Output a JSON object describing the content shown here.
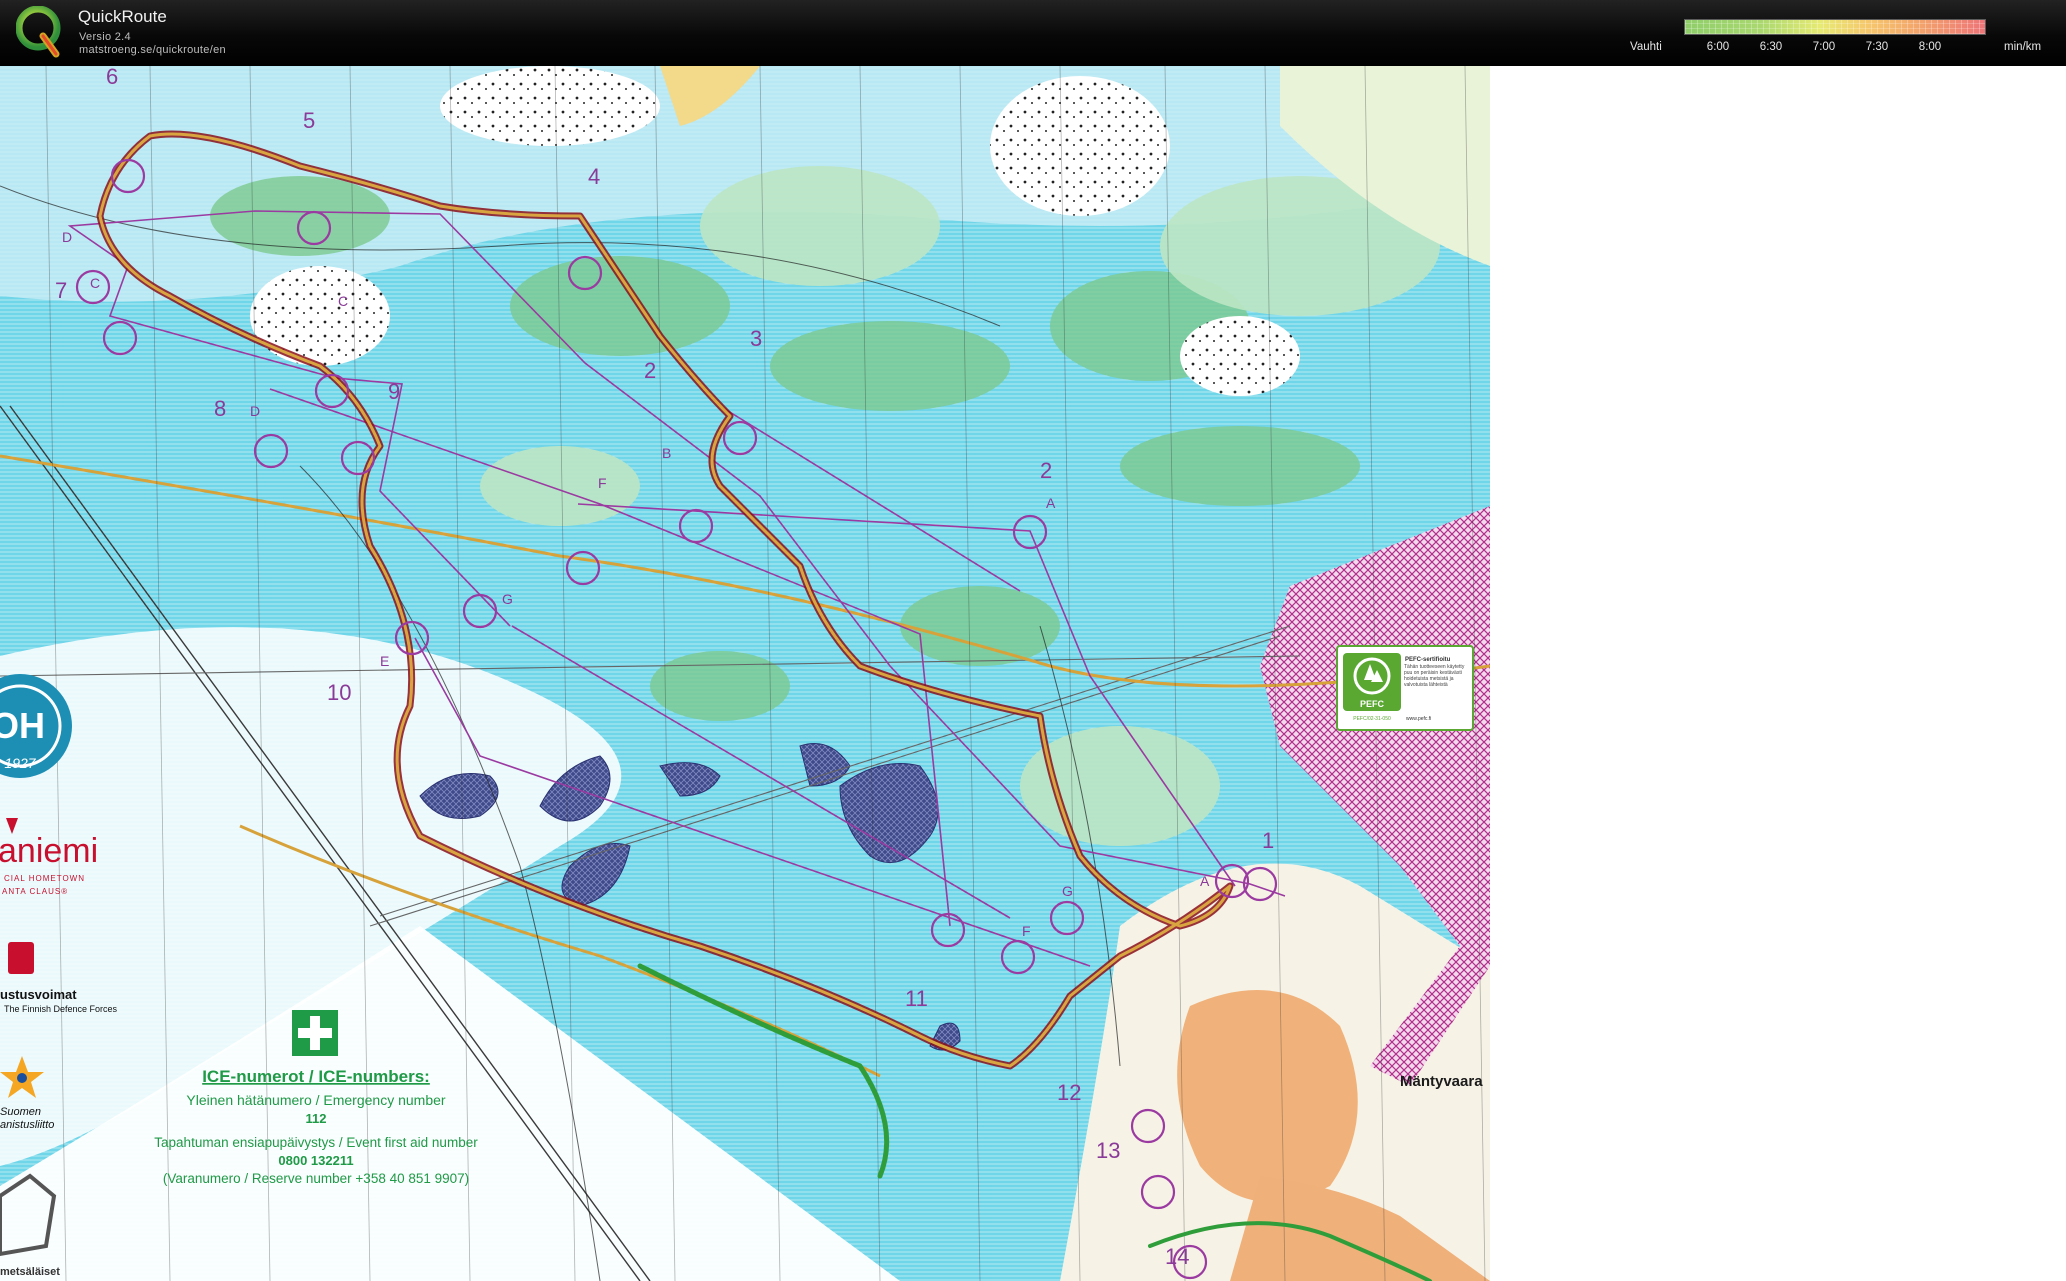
{
  "header": {
    "app_name": "QuickRoute",
    "version": "Versio 2.4",
    "url": "matstroeng.se/quickroute/en",
    "logo_letter": "Q"
  },
  "legend": {
    "label": "Vauhti",
    "unit": "min/km",
    "ticks": [
      "6:00",
      "6:30",
      "7:00",
      "7:30",
      "8:00"
    ],
    "colors": [
      "#8fce6a",
      "#e7ea73",
      "#f3a46b",
      "#ee7478"
    ]
  },
  "map": {
    "controls": [
      "1",
      "2",
      "3",
      "4",
      "5",
      "6",
      "7",
      "8",
      "9",
      "10",
      "11",
      "12",
      "13",
      "14"
    ],
    "control_letters": [
      "A",
      "B",
      "C",
      "D",
      "E",
      "F",
      "G"
    ],
    "place_name": "Mäntyvaara",
    "pefc_box": {
      "title": "PEFC-sertifioitu",
      "body": "Tähän tuotteeseen käytetty puu on peräisin kestävästi hoidetuista metsistä ja valvotuista lähteistä",
      "logo_text": "PEFC",
      "code": "PEFC/02-31-050",
      "url": "www.pefc.fi"
    },
    "left_logos": {
      "badge_year": "1927",
      "badge_letters": "OH",
      "city": "aniemi",
      "city_sub1": "CIAL HOMETOWN",
      "city_sub2": "ANTA CLAUS®",
      "defence": "ustusvoimat",
      "defence_sub": "The Finnish Defence Forces",
      "association1": "Suomen",
      "association2": "anistusliitto",
      "bottom_text": "metsäläiset"
    },
    "ice": {
      "title": "ICE-numerot / ICE-numbers:",
      "emergency_label": "Yleinen hätänumero / Emergency number",
      "emergency_number": "112",
      "firstaid_label": "Tapahtuman ensiapupäivystys / Event first aid number",
      "firstaid_number": "0800 132211",
      "reserve": "(Varanumero / Reserve number +358 40 851 9907)"
    }
  }
}
